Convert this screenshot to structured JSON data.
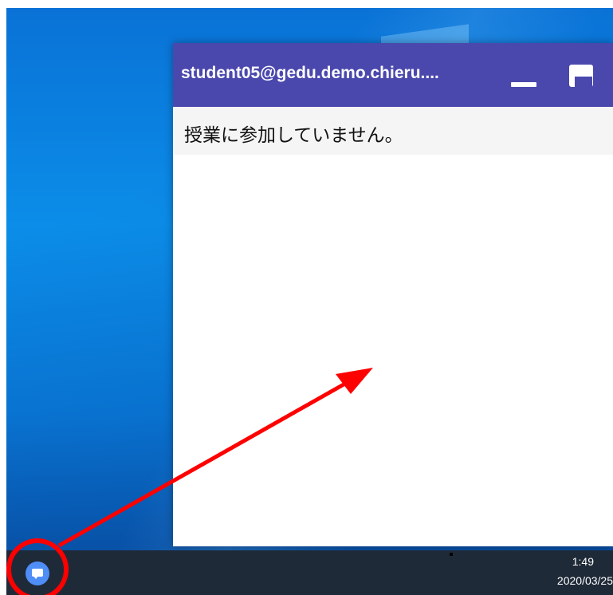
{
  "window": {
    "title": "student05@gedu.demo.chieru....",
    "status_message": "授業に参加していません。",
    "minimize_icon": "minimize-icon",
    "maximize_icon": "maximize-icon"
  },
  "taskbar": {
    "time": "1:49",
    "date": "2020/03/25",
    "app_icon": "chat-bubble-icon"
  },
  "colors": {
    "titlebar": "#4a48ad",
    "annotation": "#ff0000",
    "app_icon": "#4f8df7"
  }
}
